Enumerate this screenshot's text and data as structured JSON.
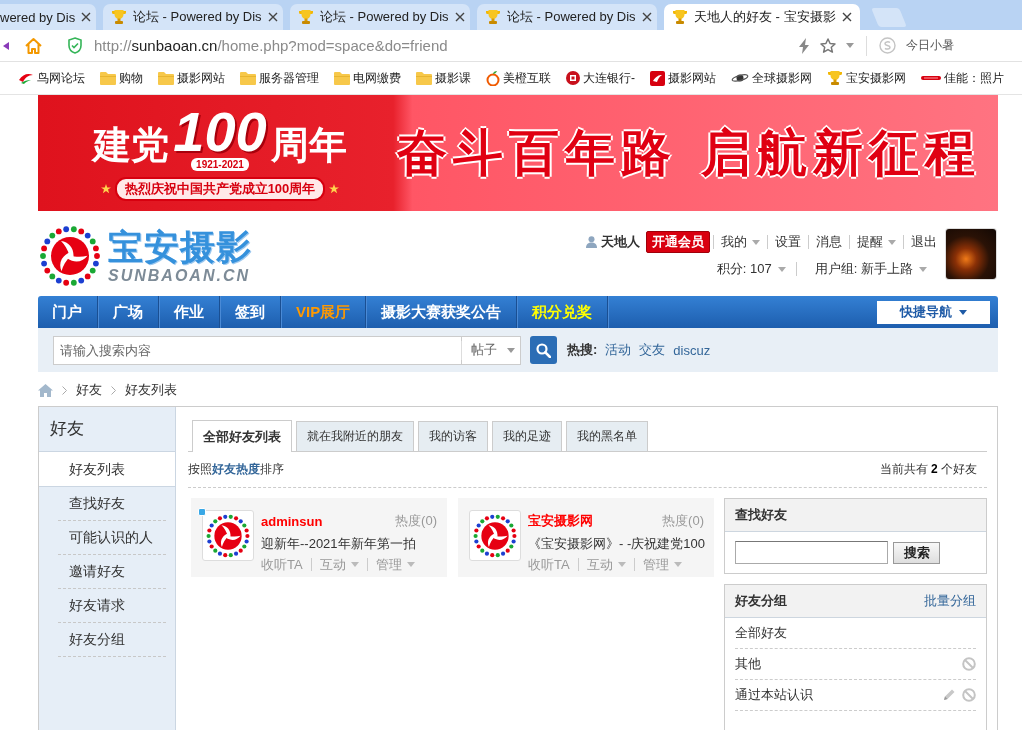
{
  "browser": {
    "tabs": [
      {
        "title": "wered by Dis",
        "selected": false,
        "icon": false
      },
      {
        "title": "论坛 - Powered by Dis",
        "selected": false,
        "icon": true
      },
      {
        "title": "论坛 - Powered by Dis",
        "selected": false,
        "icon": true
      },
      {
        "title": "论坛 - Powered by Dis",
        "selected": false,
        "icon": true
      },
      {
        "title": "天地人的好友 - 宝安摄影",
        "selected": true,
        "icon": true
      }
    ],
    "address": {
      "scheme": "http://",
      "host": "sunbaoan.cn",
      "path": "/home.php?mod=space&do=friend"
    },
    "weather": "今日小暑",
    "bookmarks": [
      {
        "label": "鸟网论坛",
        "kind": "bird"
      },
      {
        "label": "购物",
        "kind": "folder"
      },
      {
        "label": "摄影网站",
        "kind": "folder"
      },
      {
        "label": "服务器管理",
        "kind": "folder"
      },
      {
        "label": "电网缴费",
        "kind": "folder"
      },
      {
        "label": "摄影课",
        "kind": "folder"
      },
      {
        "label": "美橙互联",
        "kind": "orange"
      },
      {
        "label": "大连银行-",
        "kind": "bank"
      },
      {
        "label": "摄影网站",
        "kind": "redsquare"
      },
      {
        "label": "全球摄影网",
        "kind": "planet"
      },
      {
        "label": "宝安摄影网",
        "kind": "trophy"
      },
      {
        "label": "佳能：照片",
        "kind": "canon"
      }
    ]
  },
  "banner": {
    "title_left": "建党",
    "number": "100",
    "years": "1921-2021",
    "title_right": "周年",
    "subtitle": "热烈庆祝中国共产党成立100周年",
    "slogan": "奋斗百年路 启航新征程"
  },
  "header": {
    "logo": {
      "name": "宝安摄影",
      "domain": "SUNBAOAN.CN"
    },
    "user": "天地人",
    "vip_button": "开通会员",
    "links": [
      {
        "label": "我的",
        "dropdown": true
      },
      {
        "label": "设置",
        "dropdown": false
      },
      {
        "label": "消息",
        "dropdown": false
      },
      {
        "label": "提醒",
        "dropdown": true
      },
      {
        "label": "退出",
        "dropdown": false
      }
    ],
    "info": [
      {
        "label": "积分: 107",
        "dropdown": true
      },
      {
        "label": "用户组: 新手上路",
        "dropdown": true
      }
    ]
  },
  "nav": {
    "items": [
      {
        "label": "门户",
        "color": "#ffffff"
      },
      {
        "label": "广场",
        "color": "#ffffff"
      },
      {
        "label": "作业",
        "color": "#ffffff"
      },
      {
        "label": "签到",
        "color": "#ffffff"
      },
      {
        "label": "VIP展厅",
        "color": "#ff9900"
      },
      {
        "label": "摄影大赛获奖公告",
        "color": "#ffffff"
      },
      {
        "label": "积分兑奖",
        "color": "#ffff00"
      }
    ],
    "quick_nav": "快捷导航"
  },
  "search": {
    "placeholder": "请输入搜索内容",
    "type": "帖子",
    "hot_label": "热搜:",
    "hot": [
      "活动",
      "交友",
      "discuz"
    ]
  },
  "breadcrumb": [
    "好友",
    "好友列表"
  ],
  "sidebar": {
    "title": "好友",
    "items": [
      {
        "label": "好友列表",
        "selected": true
      },
      {
        "label": "查找好友",
        "selected": false
      },
      {
        "label": "可能认识的人",
        "selected": false
      },
      {
        "label": "邀请好友",
        "selected": false
      },
      {
        "label": "好友请求",
        "selected": false
      },
      {
        "label": "好友分组",
        "selected": false
      }
    ]
  },
  "tabs": [
    {
      "label": "全部好友列表",
      "selected": true
    },
    {
      "label": "就在我附近的朋友",
      "selected": false
    },
    {
      "label": "我的访客",
      "selected": false
    },
    {
      "label": "我的足迹",
      "selected": false
    },
    {
      "label": "我的黑名单",
      "selected": false
    }
  ],
  "sort_text": "按照**好友热度**排序",
  "count_text": "当前共有 **2** 个好友",
  "friends": [
    {
      "name": "adminsun",
      "online": true,
      "heat": "热度(0)",
      "status": "迎新年--2021年新年第一拍",
      "actions": [
        {
          "label": "收听TA",
          "dropdown": false
        },
        {
          "label": "互动",
          "dropdown": true
        },
        {
          "label": "管理",
          "dropdown": true
        }
      ]
    },
    {
      "name": "宝安摄影网",
      "online": false,
      "heat": "热度(0)",
      "status": "《宝安摄影网》- -庆祝建党100",
      "actions": [
        {
          "label": "收听TA",
          "dropdown": false
        },
        {
          "label": "互动",
          "dropdown": true
        },
        {
          "label": "管理",
          "dropdown": true
        }
      ]
    }
  ],
  "find_panel": {
    "title": "查找好友",
    "button": "搜索"
  },
  "groups_panel": {
    "title": "好友分组",
    "link": "批量分组",
    "groups": [
      {
        "label": "全部好友",
        "editable": false,
        "deletable": false
      },
      {
        "label": "其他",
        "editable": false,
        "deletable": true
      },
      {
        "label": "通过本站认识",
        "editable": true,
        "deletable": true
      }
    ]
  }
}
